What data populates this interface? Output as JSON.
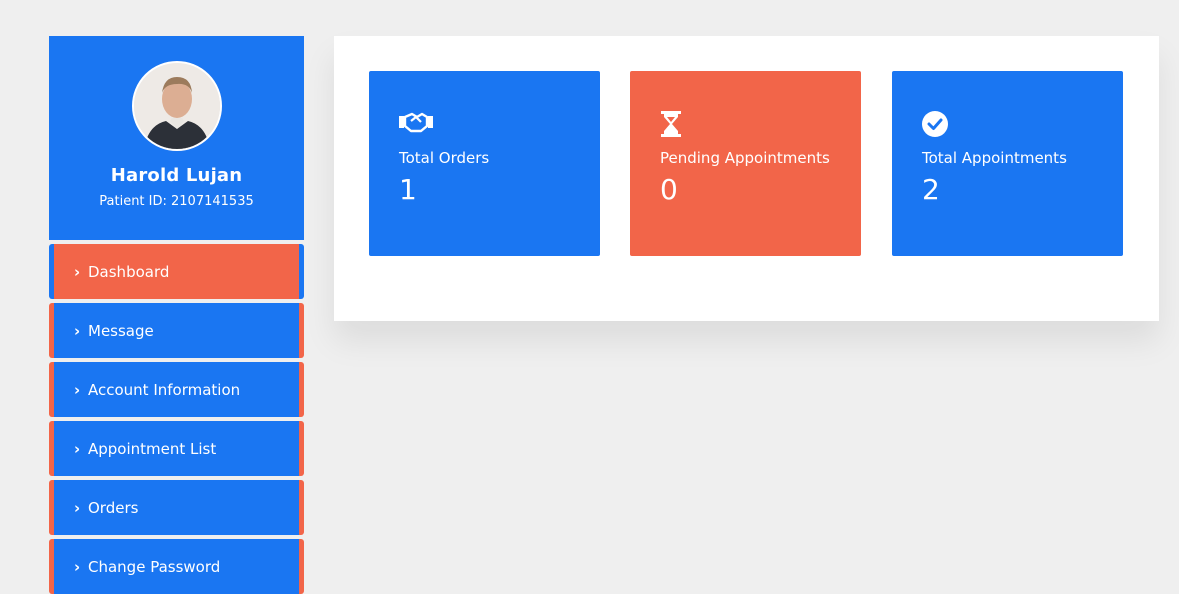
{
  "profile": {
    "name": "Harold Lujan",
    "patient_id": "Patient ID: 2107141535"
  },
  "nav": {
    "items": [
      {
        "label": "Dashboard",
        "active": true
      },
      {
        "label": "Message"
      },
      {
        "label": "Account Information"
      },
      {
        "label": "Appointment List"
      },
      {
        "label": "Orders"
      },
      {
        "label": "Change Password"
      }
    ]
  },
  "cards": [
    {
      "label": "Total Orders",
      "value": "1",
      "icon": "handshake-icon",
      "color": "#1a76f2"
    },
    {
      "label": "Pending Appointments",
      "value": "0",
      "icon": "hourglass-icon",
      "color": "#f26549"
    },
    {
      "label": "Total Appointments",
      "value": "2",
      "icon": "check-circle-icon",
      "color": "#1a76f2"
    }
  ],
  "colors": {
    "primary": "#1a76f2",
    "accent": "#f26549",
    "background": "#efefef"
  }
}
